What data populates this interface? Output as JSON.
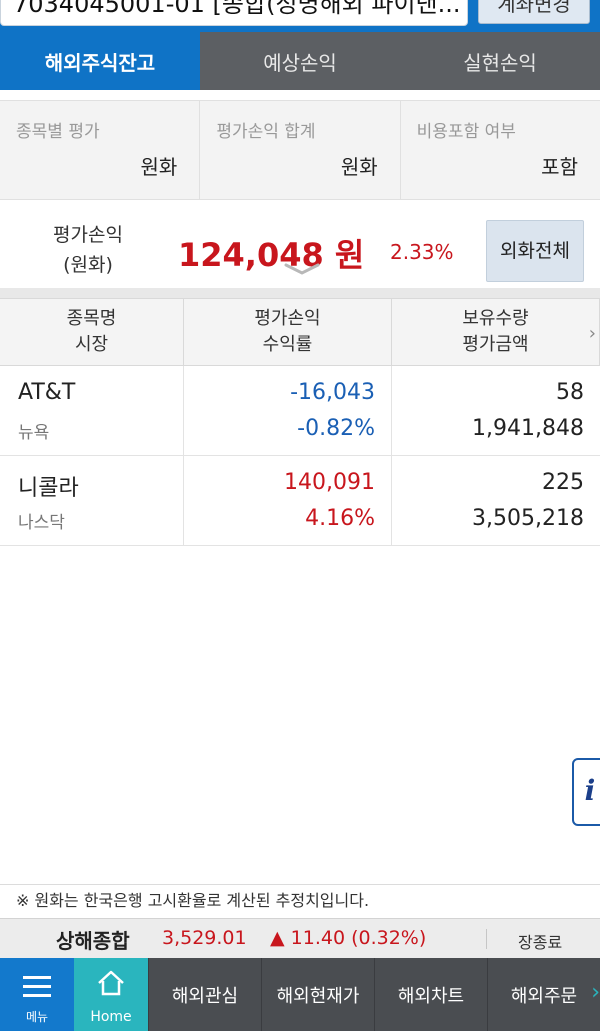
{
  "account": {
    "number_partial": "7034045001-01",
    "name_partial": "[종합(정명해외 파이낸...",
    "button_label": "계좌변경"
  },
  "tabs": [
    {
      "label": "해외주식잔고",
      "active": true
    },
    {
      "label": "예상손익",
      "active": false
    },
    {
      "label": "실현손익",
      "active": false
    }
  ],
  "filters": [
    {
      "label": "종목별 평가",
      "value": "원화"
    },
    {
      "label": "평가손익 합계",
      "value": "원화"
    },
    {
      "label": "비용포함 여부",
      "value": "포함"
    }
  ],
  "summary": {
    "label_line1": "평가손익",
    "label_line2": "(원화)",
    "amount": "124,048 원",
    "rate": "2.33%",
    "button_label": "외화전체"
  },
  "table": {
    "headers": [
      {
        "line1": "종목명",
        "line2": "시장"
      },
      {
        "line1": "평가손익",
        "line2": "수익률"
      },
      {
        "line1": "보유수량",
        "line2": "평가금액"
      }
    ],
    "rows": [
      {
        "name": "AT&T",
        "market": "뉴욕",
        "pnl": "-16,043",
        "rate": "-0.82%",
        "qty": "58",
        "value": "1,941,848",
        "direction": "down"
      },
      {
        "name": "니콜라",
        "market": "나스닥",
        "pnl": "140,091",
        "rate": "4.16%",
        "qty": "225",
        "value": "3,505,218",
        "direction": "up"
      }
    ]
  },
  "info_button": "i",
  "notice": "※ 원화는 한국은행 고시환율로 계산된 추정치입니다.",
  "ticker": {
    "name": "상해종합",
    "value": "3,529.01",
    "change": "▲ 11.40 (0.32%)",
    "status": "장종료"
  },
  "bottom_nav": {
    "menu_label": "메뉴",
    "home_label": "Home",
    "items": [
      "해외관심",
      "해외현재가",
      "해외차트",
      "해외주문"
    ]
  },
  "colors": {
    "primary_blue": "#0f73c6",
    "up_red": "#c8161d",
    "down_blue": "#1a5fb4",
    "home_teal": "#2ab5be"
  }
}
